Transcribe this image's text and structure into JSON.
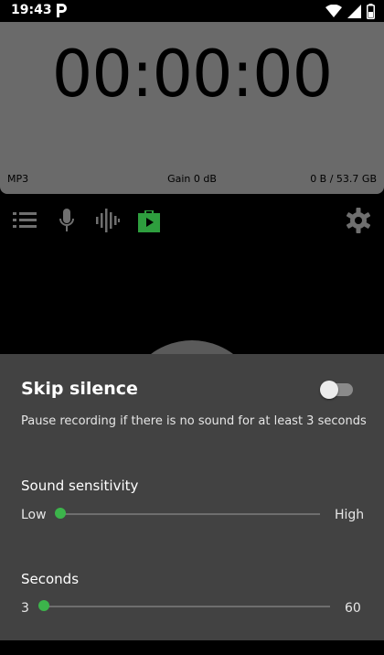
{
  "status_bar": {
    "time": "19:43"
  },
  "timer": {
    "display": "00:00:00",
    "format": "MP3",
    "gain": "Gain 0 dB",
    "storage": "0 B / 53.7 GB"
  },
  "toolbar": {
    "icons": [
      "list-icon",
      "mic-icon",
      "waveform-icon",
      "store-icon",
      "gear-icon"
    ],
    "active_color": "#2e9e3e"
  },
  "skip_silence": {
    "title": "Skip silence",
    "description": "Pause recording if there is no sound for at least 3 seconds",
    "enabled": false
  },
  "sensitivity": {
    "label": "Sound sensitivity",
    "min_label": "Low",
    "max_label": "High",
    "value_fraction": 0.0
  },
  "seconds": {
    "label": "Seconds",
    "min_label": "3",
    "max_label": "60",
    "value": 3
  },
  "colors": {
    "accent": "#3cb44b",
    "sheet_bg": "#424242",
    "card_bg": "#6a6a6a"
  }
}
